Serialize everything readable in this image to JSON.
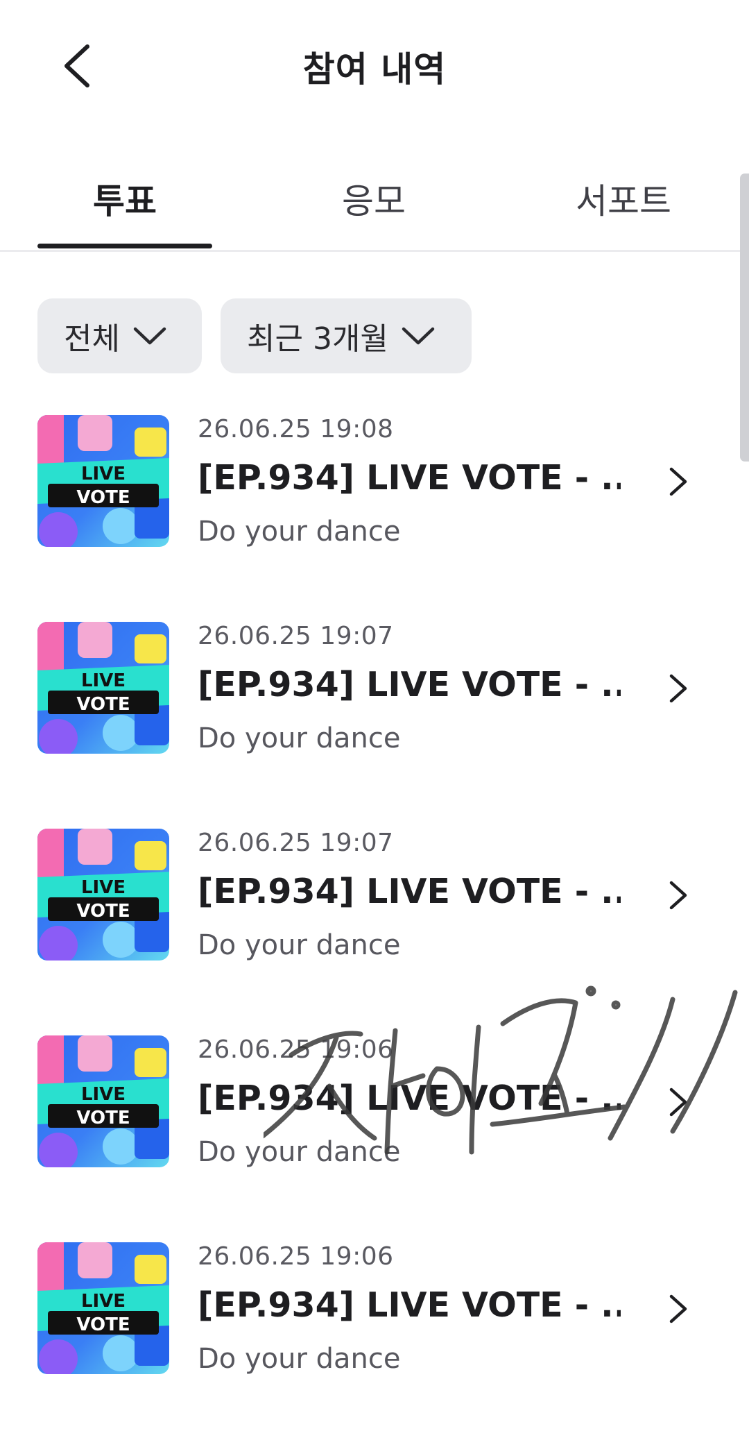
{
  "header": {
    "title": "참여 내역",
    "back_icon": "chevron-left-icon"
  },
  "tabs": [
    {
      "label": "투표",
      "active": true
    },
    {
      "label": "응모",
      "active": false
    },
    {
      "label": "서포트",
      "active": false
    }
  ],
  "filters": {
    "category": {
      "label": "전체",
      "icon": "chevron-down-icon"
    },
    "period": {
      "label": "최근 3개월",
      "icon": "chevron-down-icon"
    }
  },
  "thumbnail": {
    "line1": "LIVE",
    "line2": "VOTE"
  },
  "items": [
    {
      "date": "26.06.25 19:08",
      "title": "[EP.934] LIVE VOTE - ...",
      "subtitle": "Do your dance"
    },
    {
      "date": "26.06.25 19:07",
      "title": "[EP.934] LIVE VOTE - ...",
      "subtitle": "Do your dance"
    },
    {
      "date": "26.06.25 19:07",
      "title": "[EP.934] LIVE VOTE - ...",
      "subtitle": "Do your dance"
    },
    {
      "date": "26.06.25 19:06",
      "title": "[EP.934] LIVE VOTE - ...",
      "subtitle": "Do your dance"
    },
    {
      "date": "26.06.25 19:06",
      "title": "[EP.934] LIVE VOTE - ...",
      "subtitle": "Do your dance"
    }
  ],
  "signature": {
    "text": "차이고!"
  },
  "colors": {
    "text_primary": "#1e1e21",
    "text_secondary": "#57575e",
    "chip_bg": "#eaebee",
    "thumb_cyan": "#29e0cf",
    "thumb_blue": "#2f6cf0"
  }
}
